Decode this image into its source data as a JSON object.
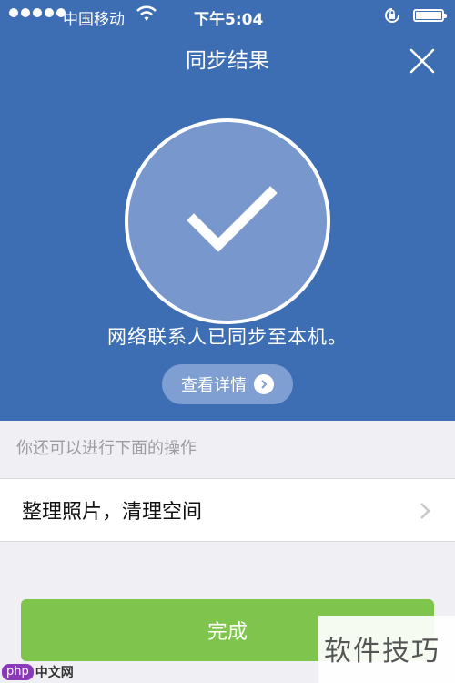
{
  "status_bar": {
    "carrier": "中国移动",
    "time": "下午5:04"
  },
  "nav": {
    "title": "同步结果"
  },
  "result": {
    "message": "网络联系人已同步至本机。",
    "details_label": "查看详情"
  },
  "section": {
    "header": "你还可以进行下面的操作"
  },
  "actions": [
    {
      "label": "整理照片，清理空间"
    }
  ],
  "footer": {
    "done_label": "完成"
  },
  "watermark": {
    "text": "软件技巧",
    "logo_badge": "php",
    "logo_site": "中文网"
  },
  "colors": {
    "header_bg": "#3d6db3",
    "done_button": "#7fc44d",
    "page_bg": "#efeff4"
  }
}
